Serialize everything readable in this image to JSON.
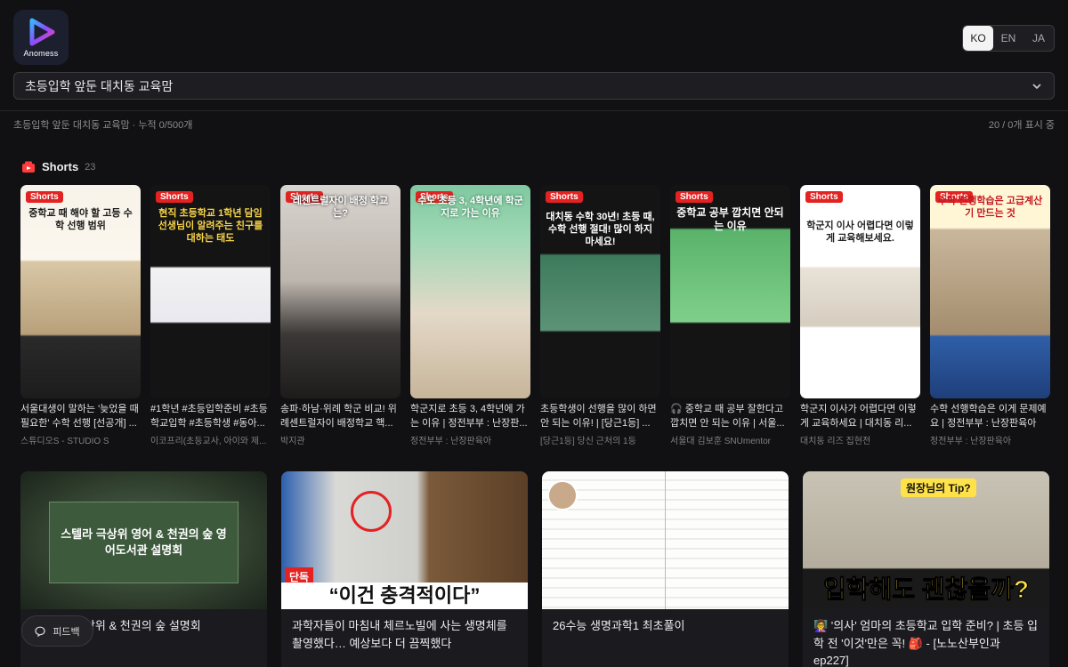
{
  "app": {
    "logo_text": "Anomess"
  },
  "languages": [
    "KO",
    "EN",
    "JA"
  ],
  "active_language": "KO",
  "channel_select": {
    "value": "초등입학 앞둔 대치동 교육맘"
  },
  "status": {
    "left": "초등입학 앞둔 대치동 교육맘 · 누적 0/500개",
    "right": "20 / 0개 표시 중"
  },
  "shorts_section": {
    "title": "Shorts",
    "count": "23",
    "badge_label": "Shorts"
  },
  "shorts": [
    {
      "caption": "중학교 때 해야 할 고등 수학 선행 범위",
      "title": "서울대생이 말하는 '늦었을 때 필요한' 수학 선행 [선공개] ...",
      "channel": "스튜디오S - STUDIO S"
    },
    {
      "caption": "현직 초등학교 1학년 담임선생님이 알려주는 친구를 대하는 태도",
      "title": "#1학년 #초등입학준비 #초등학교입학 #초등학생 #동아...",
      "channel": "이코프리(초등교사, 아이와 제..."
    },
    {
      "caption": "레센트럴자이 배정 학교는?",
      "title": "송파·하남·위례 학군 비교! 위례센트럴자이 배정학교 핵...",
      "channel": "박지관"
    },
    {
      "caption": "수도 초등 3, 4학년에 학군지로 가는 이유",
      "title": "학군지로 초등 3, 4학년에 가는 이유 | 정전부부 : 난장판...",
      "channel": "정전부부 : 난장판육아"
    },
    {
      "caption": "대치동 수학 30년! 초등 때, 수학 선행 절대! 많이 하지 마세요!",
      "title": "초등학생이 선행을 많이 하면 안 되는 이유! | [당근1등] ...",
      "channel": "[당근1등] 당신 근처의 1등"
    },
    {
      "caption": "중학교 공부 깝치면 안되는 이유",
      "title": "🎧 중학교 때 공부 잘한다고 깝치면 안 되는 이유 | 서울...",
      "channel": "서울대 김보훈 SNUmentor"
    },
    {
      "caption": "학군지 이사 어렵다면 이렇게 교육해보세요.",
      "title": "학군지 이사가 어렵다면 이렇게 교육하세요 | 대치동 리...",
      "channel": "대치동 리즈 집현전"
    },
    {
      "caption": "수학 선행학습은 고급계산기 만드는 것",
      "title": "수학 선행학습은 이게 문제예요 | 정전부부 : 난장판육아",
      "channel": "정전부부 : 난장판육아"
    }
  ],
  "videos": [
    {
      "thumb_text": "스텔라 극상위 영어 & 천권의 숲 영어도서관 설명회",
      "title": "극상위 & 천권의 숲 설명회"
    },
    {
      "thumb_text": "“이건 충격적이다”",
      "title": "과학자들이 마침내 체르노빌에 사는 생명체를 촬영했다… 예상보다 더 끔찍했다"
    },
    {
      "thumb_text": "",
      "title": "26수능 생명과학1 최초풀이"
    },
    {
      "thumb_text": "입학해도 괜찮을까?",
      "title": "👩‍🏫 '의사' 엄마의 초등학교 입학 준비? | 초등 입학 전 '이것'만은 꼭! 🎒 - [노노산부인과 ep227]"
    }
  ],
  "feedback": {
    "label": "피드백"
  },
  "colors": {
    "badge_red": "#e32222",
    "background": "#111114"
  }
}
